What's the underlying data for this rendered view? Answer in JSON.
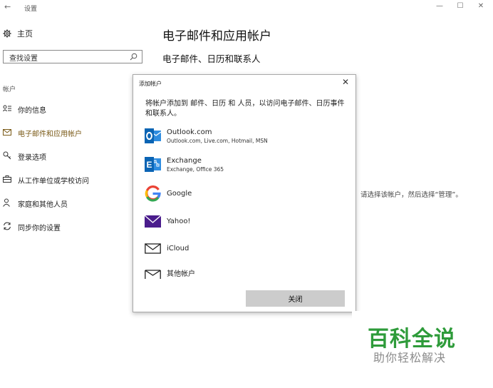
{
  "window": {
    "back_glyph": "←",
    "title": "设置",
    "minimize": "—",
    "maximize": "☐",
    "close": "✕"
  },
  "sidebar": {
    "home_label": "主页",
    "search_placeholder": "查找设置",
    "section_label": "帐户",
    "items": [
      {
        "label": "你的信息",
        "icon": "person-list-icon"
      },
      {
        "label": "电子邮件和应用帐户",
        "icon": "mail-icon",
        "active": true
      },
      {
        "label": "登录选项",
        "icon": "key-icon"
      },
      {
        "label": "从工作单位或学校访问",
        "icon": "briefcase-icon"
      },
      {
        "label": "家庭和其他人员",
        "icon": "people-icon"
      },
      {
        "label": "同步你的设置",
        "icon": "sync-icon"
      }
    ]
  },
  "main": {
    "title": "电子邮件和应用帐户",
    "subtitle": "电子邮件、日历和联系人",
    "hint": "请选择该帐户，然后选择“管理”。"
  },
  "dialog": {
    "title": "添加帐户",
    "description": "将帐户添加到 邮件、日历 和 人员，以访问电子邮件、日历事件和联系人。",
    "accounts": [
      {
        "name": "Outlook.com",
        "sub": "Outlook.com, Live.com, Hotmail, MSN",
        "icon": "outlook-icon"
      },
      {
        "name": "Exchange",
        "sub": "Exchange, Office 365",
        "icon": "exchange-icon"
      },
      {
        "name": "Google",
        "sub": "",
        "icon": "google-icon"
      },
      {
        "name": "Yahoo!",
        "sub": "",
        "icon": "yahoo-icon"
      },
      {
        "name": "iCloud",
        "sub": "",
        "icon": "icloud-icon"
      },
      {
        "name": "其他帐户",
        "sub": "",
        "icon": "other-mail-icon"
      }
    ],
    "close_label": "关闭"
  },
  "watermark": {
    "brand": "百科全说",
    "slogan": "助你轻松解决"
  },
  "colors": {
    "accent": "#7a5a17",
    "outlook_blue": "#0a64b4",
    "yahoo_purple": "#4a1c8c",
    "watermark_green": "#2e9b3a"
  }
}
